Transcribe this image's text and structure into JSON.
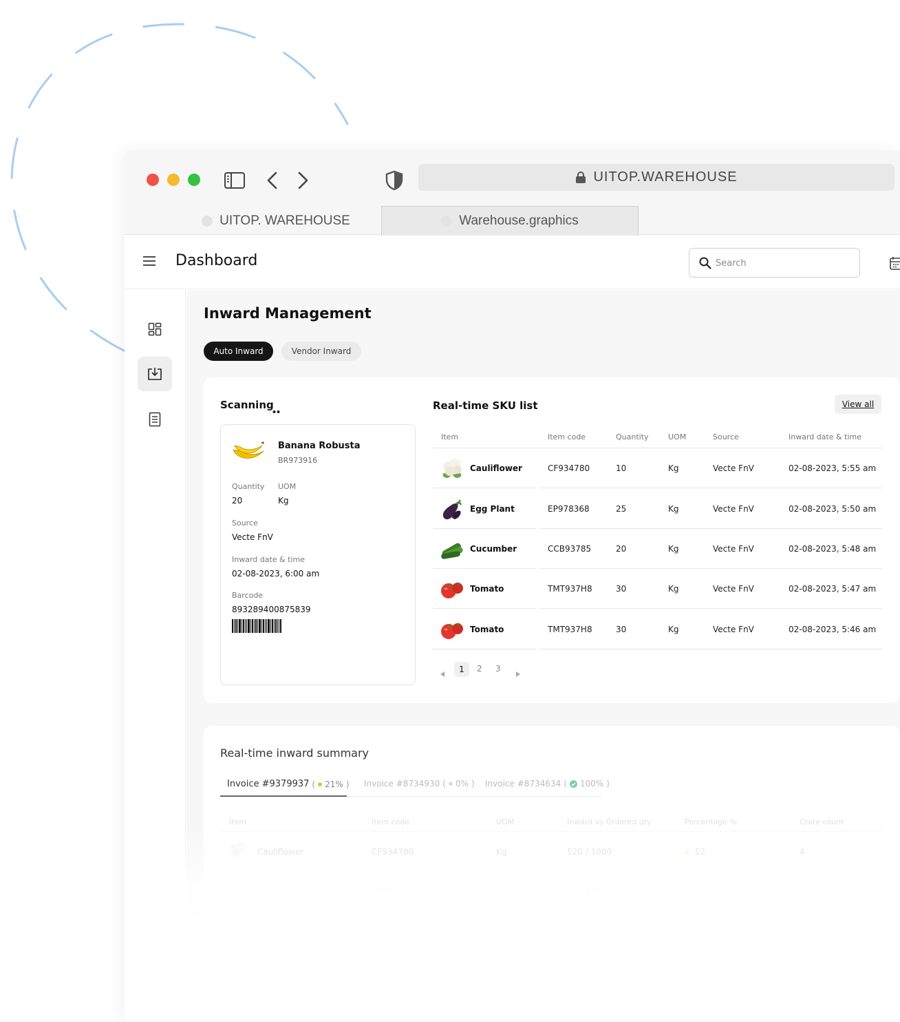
{
  "browser": {
    "url": "UITOP.WAREHOUSE",
    "tabs": [
      {
        "label": "UITOP. WAREHOUSE"
      },
      {
        "label": "Warehouse.graphics"
      }
    ]
  },
  "header": {
    "title": "Dashboard",
    "search_placeholder": "Search"
  },
  "main": {
    "title": "Inward Management",
    "tabs": [
      {
        "label": "Auto Inward",
        "active": true
      },
      {
        "label": "Vendor Inward",
        "active": false
      }
    ]
  },
  "scanning": {
    "title": "Scanning",
    "item_name": "Banana Robusta",
    "item_code": "BR973916",
    "quantity_label": "Quantity",
    "quantity": "20",
    "uom_label": "UOM",
    "uom": "Kg",
    "source_label": "Source",
    "source": "Vecte FnV",
    "inward_label": "Inward date & time",
    "inward": "02-08-2023, 6:00 am",
    "barcode_label": "Barcode",
    "barcode": "893289400875839"
  },
  "sku": {
    "title": "Real-time SKU list",
    "view_all": "View all",
    "columns": [
      "Item",
      "Item code",
      "Quantity",
      "UOM",
      "Source",
      "Inward date & time"
    ],
    "rows": [
      {
        "item": "Cauliflower",
        "code": "CF934780",
        "qty": "10",
        "uom": "Kg",
        "source": "Vecte FnV",
        "date": "02-08-2023, 5:55 am"
      },
      {
        "item": "Egg Plant",
        "code": "EP978368",
        "qty": "25",
        "uom": "Kg",
        "source": "Vecte FnV",
        "date": "02-08-2023, 5:50 am"
      },
      {
        "item": "Cucumber",
        "code": "CCB93785",
        "qty": "20",
        "uom": "Kg",
        "source": "Vecte FnV",
        "date": "02-08-2023, 5:48 am"
      },
      {
        "item": "Tomato",
        "code": "TMT937H8",
        "qty": "30",
        "uom": "Kg",
        "source": "Vecte FnV",
        "date": "02-08-2023, 5:47 am"
      },
      {
        "item": "Tomato",
        "code": "TMT937H8",
        "qty": "30",
        "uom": "Kg",
        "source": "Vecte FnV",
        "date": "02-08-2023, 5:46 am"
      }
    ],
    "pagination": {
      "pages": [
        "1",
        "2",
        "3"
      ],
      "current": "1"
    }
  },
  "summary": {
    "title": "Real-time inward summary",
    "invoices": [
      {
        "label": "Invoice #9379937",
        "pct": "21%",
        "status_color": "#f4bb2e"
      },
      {
        "label": "Invoice #8734930",
        "pct": "0%",
        "status_color": "#bbbbbb"
      },
      {
        "label": "Invoice #8734634",
        "pct": "100%",
        "status_color": "#35b36a"
      }
    ],
    "columns": [
      "Item",
      "Item code",
      "UOM",
      "Inward vs Ordered qty",
      "Percentage %",
      "Crate count"
    ],
    "rows": [
      {
        "item": "Cauliflower",
        "code": "CF934780",
        "uom": "Kg",
        "qty": "520 / 1000",
        "pct": "52",
        "crates": "4"
      },
      {
        "item": "Egg Plant",
        "code": "EP978368",
        "uom": "Kg",
        "qty": "25 / 1000",
        "pct": "2.5",
        "crates": "1"
      }
    ]
  },
  "colors": {
    "accent_dark": "#161616",
    "deco_line": "#a9cdf2",
    "traffic_red": "#f0524a",
    "traffic_yellow": "#f4bb2e",
    "traffic_green": "#35c244"
  }
}
